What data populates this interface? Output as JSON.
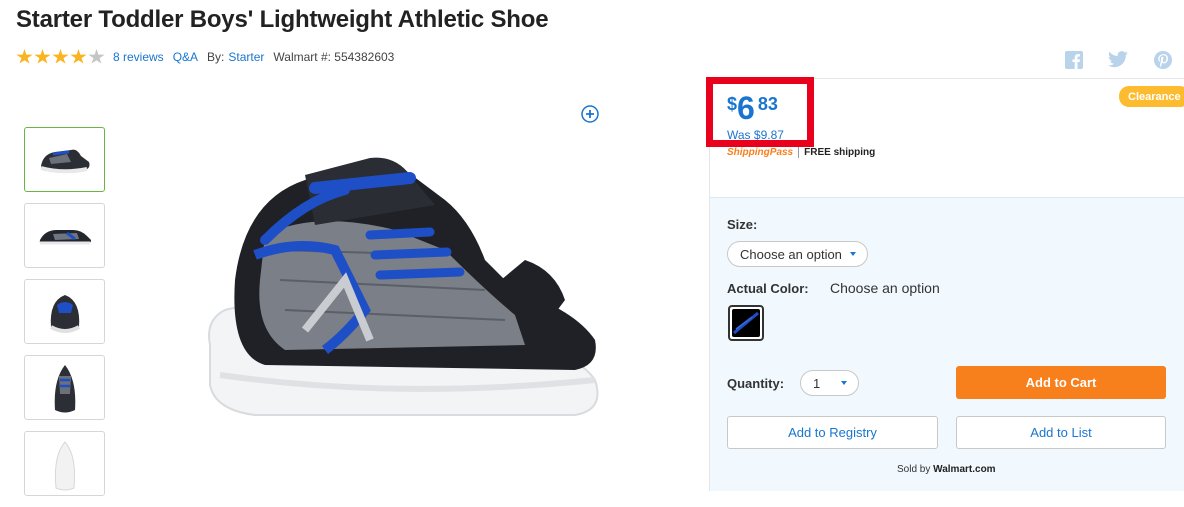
{
  "product": {
    "title": "Starter Toddler Boys' Lightweight Athletic Shoe",
    "rating": 4,
    "rating_max": 5,
    "reviews_label": "8 reviews",
    "qa_label": "Q&A",
    "by_label": "By:",
    "brand": "Starter",
    "walmart_number": "Walmart #: 554382603"
  },
  "social": [
    "facebook-icon",
    "twitter-icon",
    "pinterest-icon"
  ],
  "gallery": {
    "thumbnail_count": 5,
    "active_index": 0
  },
  "pricing": {
    "currency": "$",
    "dollars": "6",
    "cents": "83",
    "was_price": "Was $9.87",
    "badge": "Clearance",
    "shipping_pass": "ShippingPass",
    "shipping_text": "FREE shipping"
  },
  "options": {
    "size_label": "Size:",
    "size_value": "Choose an option",
    "color_label": "Actual Color:",
    "color_value": "Choose an option",
    "quantity_label": "Quantity:",
    "quantity_value": "1"
  },
  "actions": {
    "add_to_cart": "Add to Cart",
    "add_to_registry": "Add to Registry",
    "add_to_list": "Add to List",
    "sold_by_label": "Sold by",
    "sold_by": "Walmart.com"
  },
  "colors": {
    "price_blue": "#1a75cf",
    "cart_orange": "#f77f1c",
    "clearance_yellow": "#fdbb30",
    "highlight_red": "#e8001c"
  }
}
